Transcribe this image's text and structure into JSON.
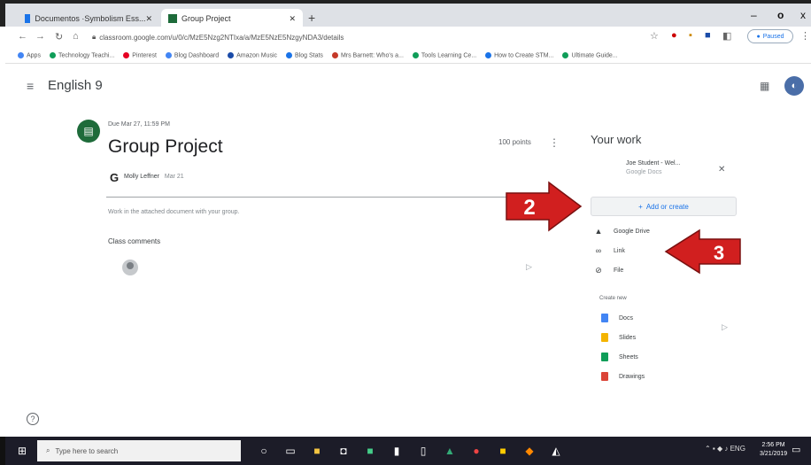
{
  "browser": {
    "tabs": [
      {
        "label": "Documentos ·Symbolism Ess...",
        "fav_color": "#1a73e8"
      },
      {
        "label": "Group Project",
        "fav_color": "#1e6b3a"
      }
    ],
    "new_tab": "+",
    "window_controls": [
      "–",
      "o",
      "x"
    ],
    "address": "classroom.google.com/u/0/c/MzE5Nzg2NTIxa/a/MzE5NzE5NzgyNDA3/details",
    "resume_label": "Paused",
    "bookmarks": [
      {
        "label": "Apps",
        "color": "#4285f4"
      },
      {
        "label": "Technology Teachi...",
        "color": "#0f9d58"
      },
      {
        "label": "Pinterest",
        "color": "#e60023"
      },
      {
        "label": "Blog Dashboard",
        "color": "#4285f4"
      },
      {
        "label": "Amazon Music",
        "color": "#1a4ba8"
      },
      {
        "label": "Blog Stats",
        "color": "#1a73e8"
      },
      {
        "label": "Mrs Barnett: Who's a...",
        "color": "#c53929"
      },
      {
        "label": "Tools Learning Ce...",
        "color": "#0f9d58"
      },
      {
        "label": "How to Create STM...",
        "color": "#1a73e8"
      },
      {
        "label": "Ultimate Guide...",
        "color": "#0f9d58"
      }
    ]
  },
  "classroom": {
    "class_name": "English 9",
    "assignment": {
      "due": "Due Mar 27, 11:59 PM",
      "title": "Group Project",
      "points": "100 points",
      "author": "Molly Leffner",
      "date": "Mar 21",
      "instructions": "Work in the attached document with your group.",
      "class_comments_label": "Class comments"
    },
    "your_work": {
      "title": "Your work",
      "attachment_name": "Joe Student - Wel...",
      "attachment_sub": "Google Docs",
      "add_create": "Add or create",
      "menu": [
        {
          "label": "Google Drive",
          "icon": "google-drive-icon",
          "glyph": "▲"
        },
        {
          "label": "Link",
          "icon": "link-icon",
          "glyph": "∞"
        },
        {
          "label": "File",
          "icon": "file-icon",
          "glyph": "⊘"
        }
      ],
      "create_new_label": "Create new",
      "create_items": [
        {
          "label": "Docs",
          "color": "#4285f4"
        },
        {
          "label": "Slides",
          "color": "#f4b400"
        },
        {
          "label": "Sheets",
          "color": "#0f9d58"
        },
        {
          "label": "Drawings",
          "color": "#db4437"
        }
      ]
    }
  },
  "callouts": [
    {
      "number": "2",
      "color": "#d11f1f"
    },
    {
      "number": "3",
      "color": "#d11f1f"
    }
  ],
  "taskbar": {
    "search_placeholder": "Type here to search",
    "time": "2:56 PM",
    "date": "3/21/2019"
  }
}
